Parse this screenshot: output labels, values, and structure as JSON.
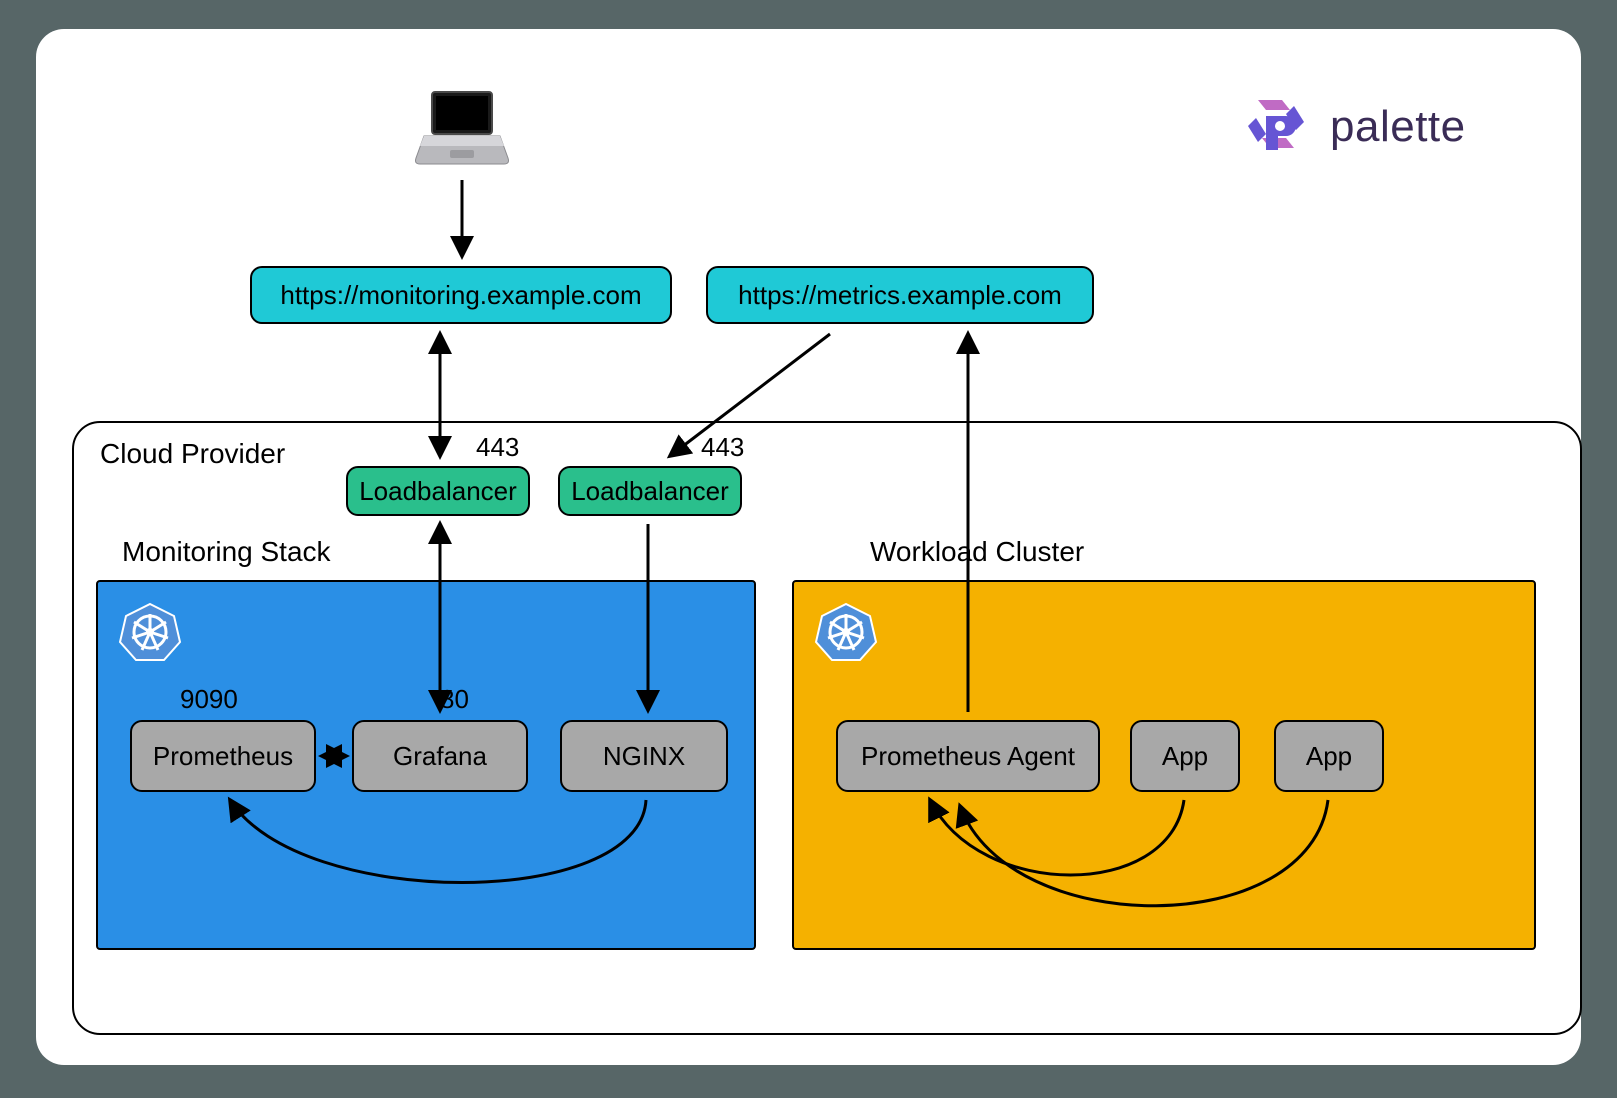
{
  "brand": {
    "name": "palette"
  },
  "urls": {
    "monitoring": "https://monitoring.example.com",
    "metrics": "https://metrics.example.com"
  },
  "cloud": {
    "label": "Cloud Provider"
  },
  "lb": {
    "left": {
      "label": "Loadbalancer",
      "port": "443"
    },
    "right": {
      "label": "Loadbalancer",
      "port": "443"
    }
  },
  "clusters": {
    "monitoring": {
      "label": "Monitoring Stack",
      "services": {
        "prometheus": {
          "label": "Prometheus",
          "port": "9090"
        },
        "grafana": {
          "label": "Grafana",
          "port": "80"
        },
        "nginx": {
          "label": "NGINX"
        }
      }
    },
    "workload": {
      "label": "Workload Cluster",
      "services": {
        "agent": {
          "label": "Prometheus Agent"
        },
        "app1": {
          "label": "App"
        },
        "app2": {
          "label": "App"
        }
      }
    }
  },
  "icons": {
    "laptop": "laptop-icon",
    "k8s": "kubernetes-icon",
    "palette": "palette-logo-icon"
  }
}
